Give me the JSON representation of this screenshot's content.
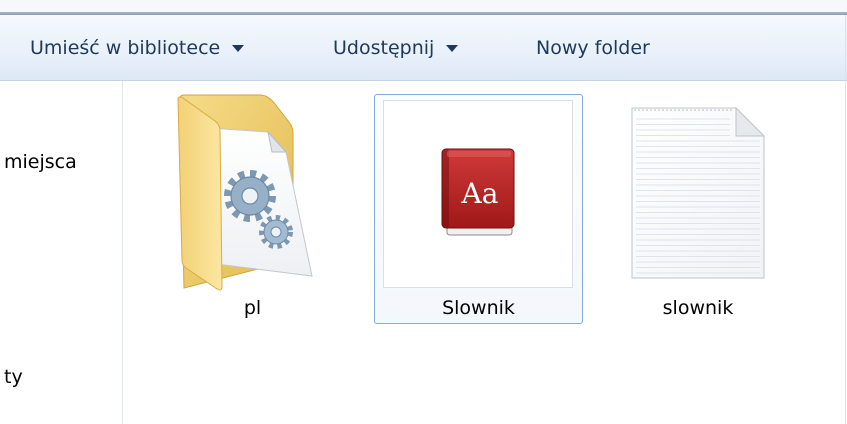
{
  "toolbar": {
    "items": [
      {
        "label": "Umieść w bibliotece",
        "dropdown": true,
        "icon": "chevron-down-icon"
      },
      {
        "label": "Udostępnij",
        "dropdown": true,
        "icon": "chevron-down-icon"
      },
      {
        "label": "Nowy folder",
        "dropdown": false
      }
    ]
  },
  "nav": {
    "items": [
      {
        "label": "miejsca"
      },
      {
        "label": "ty"
      }
    ]
  },
  "files": [
    {
      "name": "pl",
      "icon": "folder-with-gears-icon",
      "selected": false
    },
    {
      "name": "Slownik",
      "icon": "dictionary-book-icon",
      "icon_text": "Aa",
      "selected": true
    },
    {
      "name": "slownik",
      "icon": "text-document-icon",
      "selected": false
    }
  ],
  "colors": {
    "toolbar_text": "#1e395b",
    "toolbar_bg_top": "#f6f9fd",
    "toolbar_bg_bottom": "#dde8f5",
    "selection_border": "#84acdd",
    "folder_yellow": "#f3d175",
    "book_red": "#b31f1f",
    "label_text": "#000000"
  }
}
